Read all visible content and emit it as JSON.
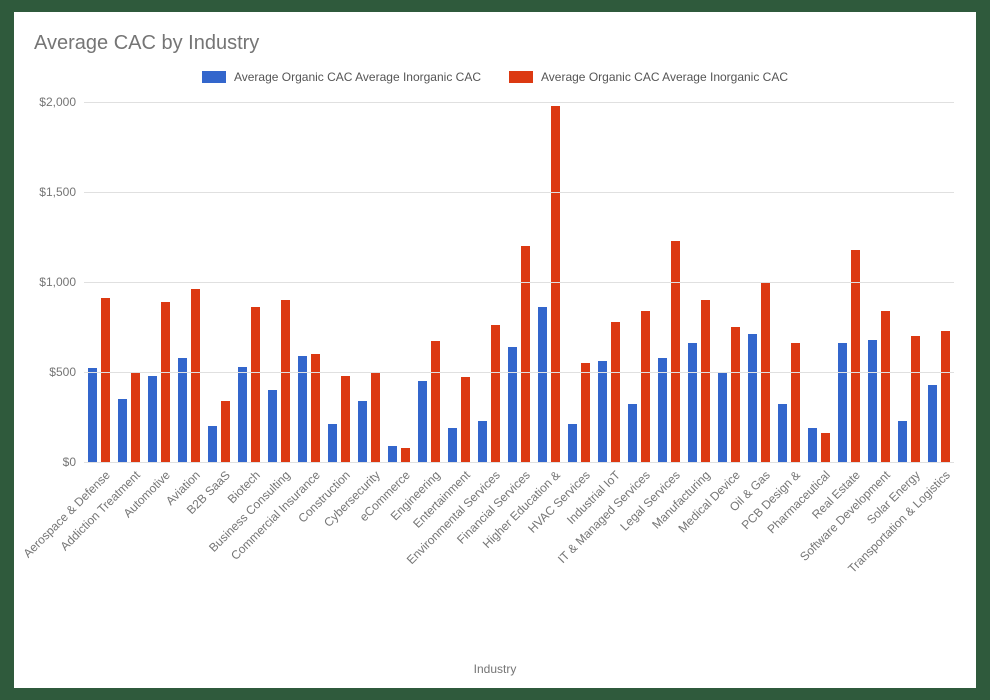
{
  "chart_data": {
    "type": "bar",
    "title": "Average CAC by Industry",
    "xlabel": "Industry",
    "ylabel": "",
    "ylim": [
      0,
      2000
    ],
    "y_ticks": [
      "$0",
      "$500",
      "$1,000",
      "$1,500",
      "$2,000"
    ],
    "colors": {
      "organic": "#3366cc",
      "inorganic": "#dc3912"
    },
    "legend": [
      "Average Organic CAC Average Inorganic CAC",
      "Average Organic CAC Average Inorganic CAC"
    ],
    "categories": [
      "Aerospace & Defense",
      "Addiction Treatment",
      "Automotive",
      "Aviation",
      "B2B SaaS",
      "Biotech",
      "Business Consulting",
      "Commercial Insurance",
      "Construction",
      "Cybersecurity",
      "eCommerce",
      "Engineering",
      "Entertainment",
      "Environmental Services",
      "Financial Services",
      "Higher Education &",
      "HVAC Services",
      "Industrial IoT",
      "IT & Managed Services",
      "Legal Services",
      "Manufacturing",
      "Medical Device",
      "Oil & Gas",
      "PCB Design &",
      "Pharmaceutical",
      "Real Estate",
      "Software Development",
      "Solar Energy",
      "Transportation & Logistics"
    ],
    "series": [
      {
        "name": "Average Organic CAC",
        "values": [
          520,
          350,
          480,
          580,
          200,
          530,
          400,
          590,
          210,
          340,
          90,
          450,
          190,
          230,
          640,
          860,
          210,
          560,
          320,
          580,
          660,
          500,
          710,
          320,
          190,
          660,
          680,
          230,
          430
        ]
      },
      {
        "name": "Average Inorganic CAC",
        "values": [
          910,
          500,
          890,
          960,
          340,
          860,
          900,
          600,
          480,
          500,
          80,
          670,
          470,
          760,
          1200,
          1980,
          550,
          780,
          840,
          1230,
          900,
          750,
          1000,
          660,
          160,
          1180,
          840,
          700,
          730
        ]
      }
    ]
  }
}
